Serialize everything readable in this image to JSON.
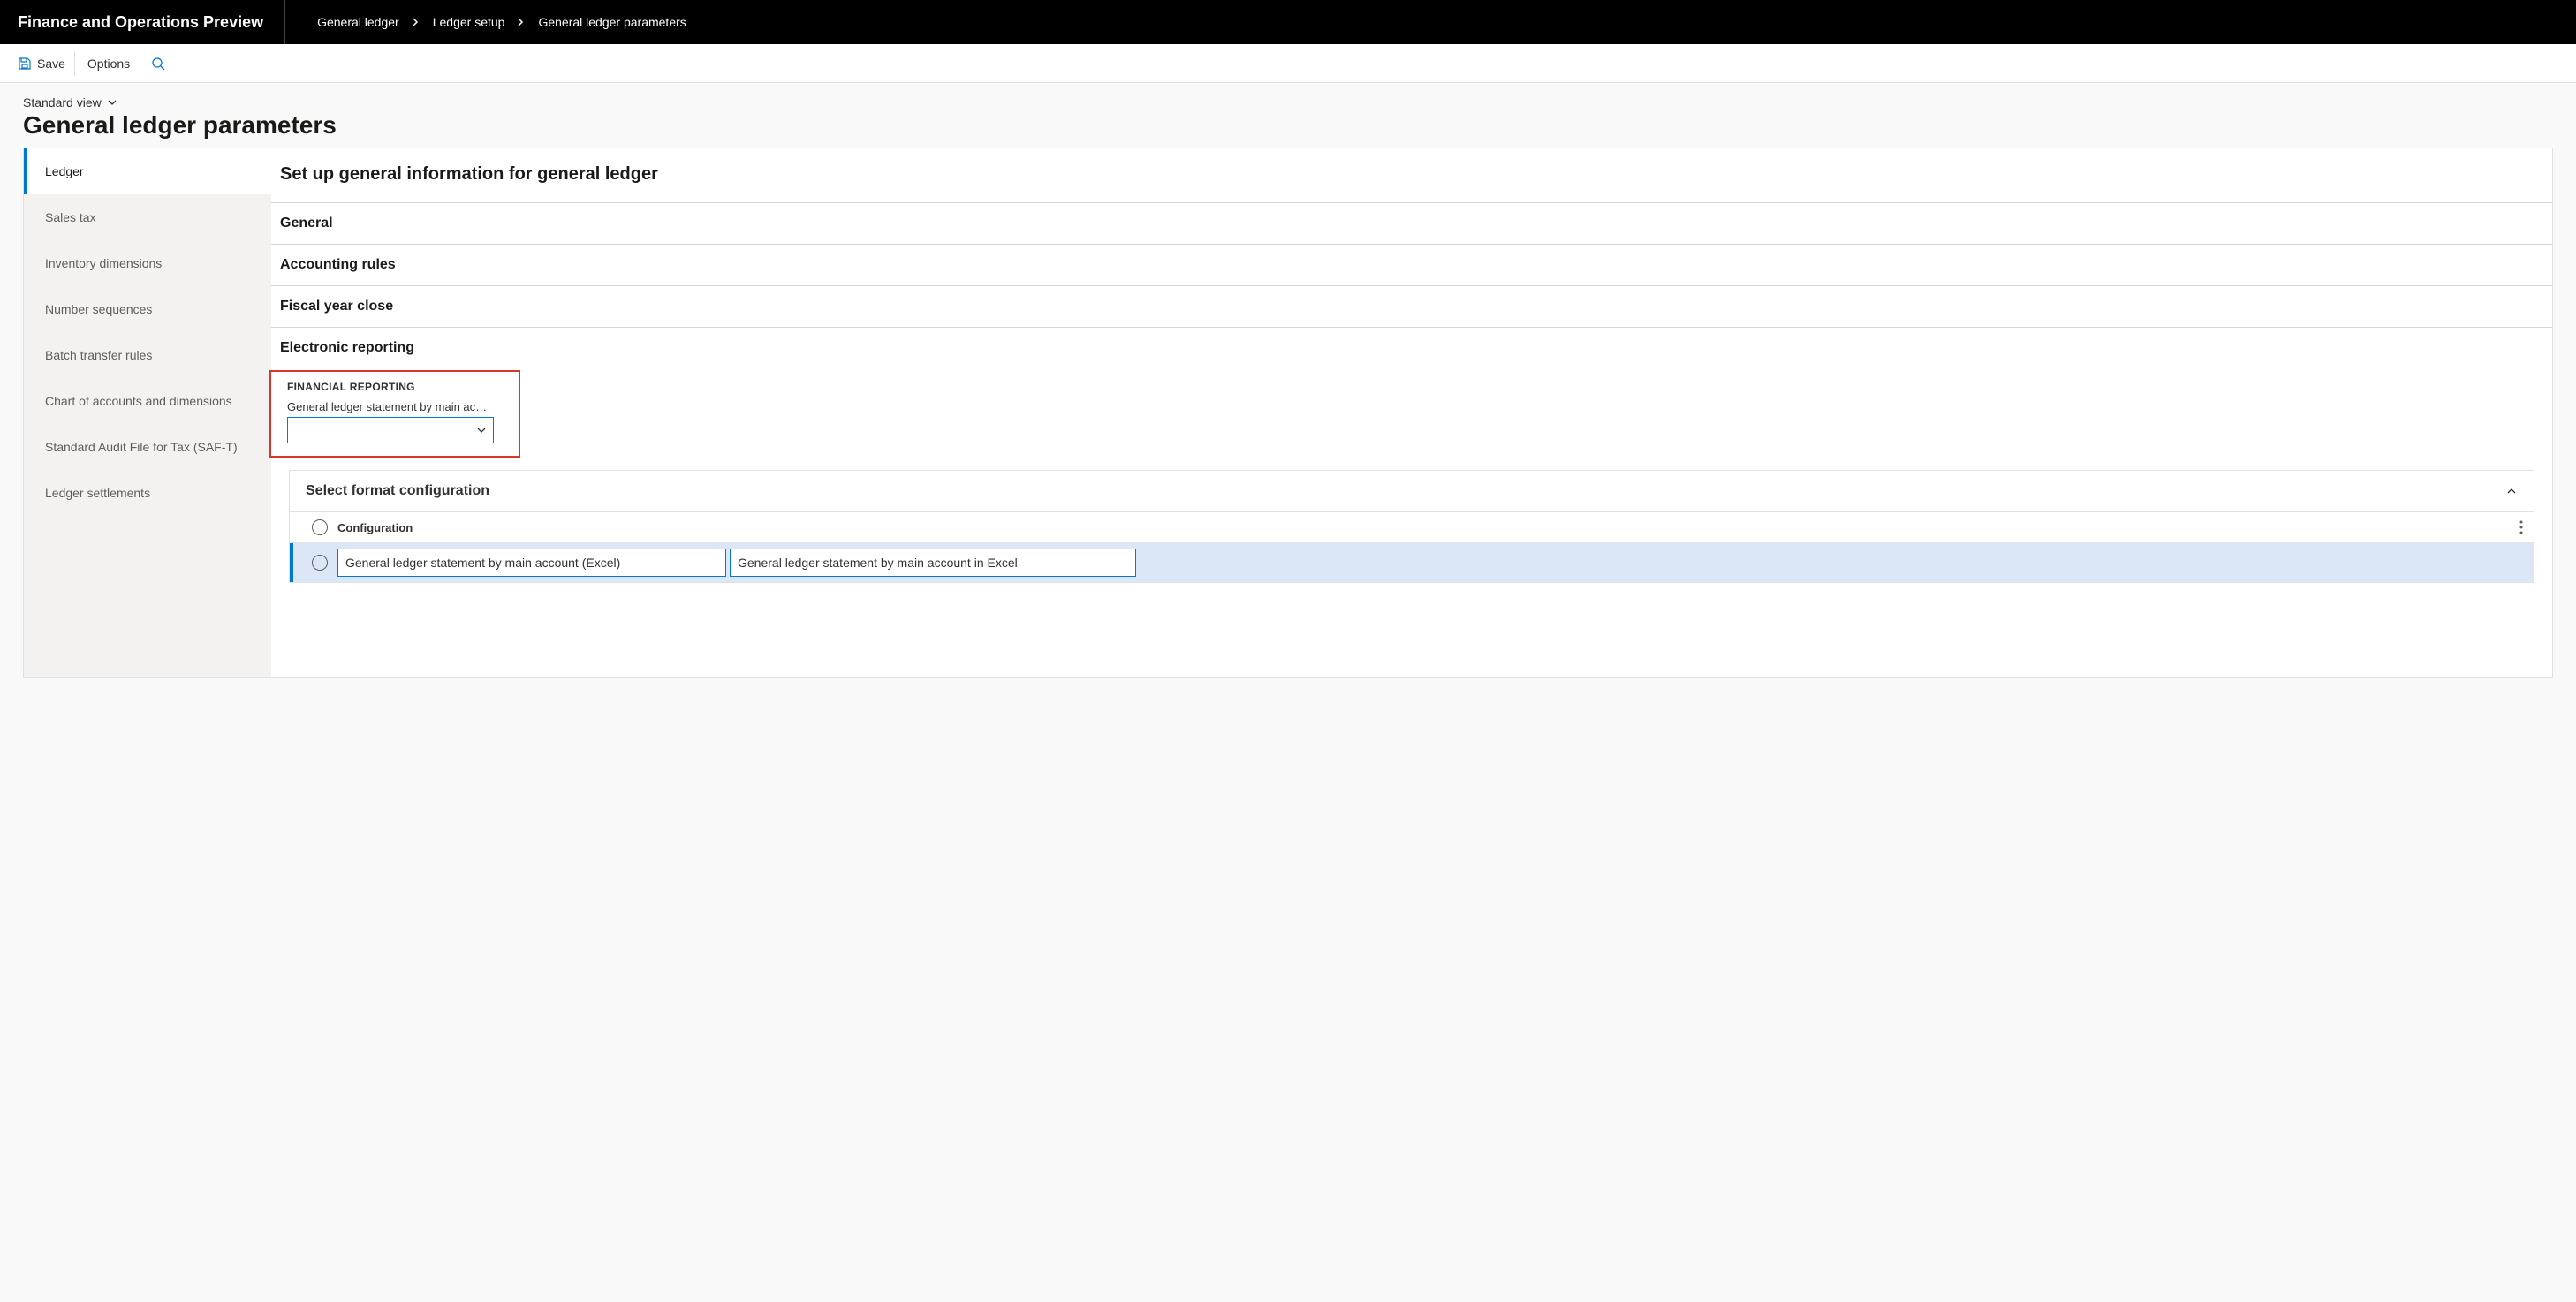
{
  "app": {
    "title": "Finance and Operations Preview"
  },
  "breadcrumb": {
    "items": [
      "General ledger",
      "Ledger setup",
      "General ledger parameters"
    ]
  },
  "actions": {
    "save": "Save",
    "options": "Options"
  },
  "header": {
    "view": "Standard view",
    "title": "General ledger parameters"
  },
  "sidenav": {
    "items": [
      "Ledger",
      "Sales tax",
      "Inventory dimensions",
      "Number sequences",
      "Batch transfer rules",
      "Chart of accounts and dimensions",
      "Standard Audit File for Tax (SAF-T)",
      "Ledger settlements"
    ],
    "active_index": 0
  },
  "panel": {
    "title": "Set up general information for general ledger",
    "sections": [
      "General",
      "Accounting rules",
      "Fiscal year close",
      "Electronic reporting"
    ]
  },
  "financial_reporting": {
    "group_label": "FINANCIAL REPORTING",
    "field_label": "General ledger statement by main acc...",
    "value": ""
  },
  "dropdown": {
    "title": "Select format configuration",
    "column_header": "Configuration",
    "rows": [
      {
        "name": "General ledger statement by main account (Excel)",
        "description": "General ledger statement by main account in Excel"
      }
    ]
  }
}
